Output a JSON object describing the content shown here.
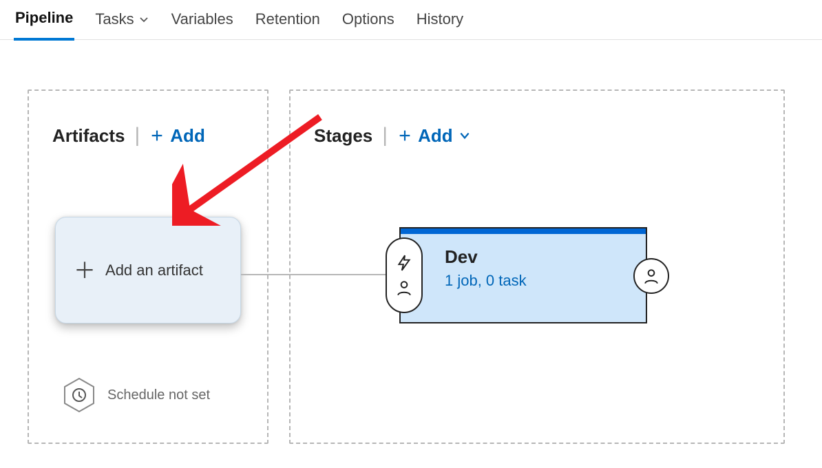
{
  "tabs": {
    "pipeline": "Pipeline",
    "tasks": "Tasks",
    "variables": "Variables",
    "retention": "Retention",
    "options": "Options",
    "history": "History"
  },
  "artifacts": {
    "title": "Artifacts",
    "add_label": "Add",
    "card_text": "Add an artifact",
    "schedule_text": "Schedule not set"
  },
  "stages": {
    "title": "Stages",
    "add_label": "Add",
    "stage": {
      "name": "Dev",
      "meta": "1 job, 0 task"
    }
  }
}
